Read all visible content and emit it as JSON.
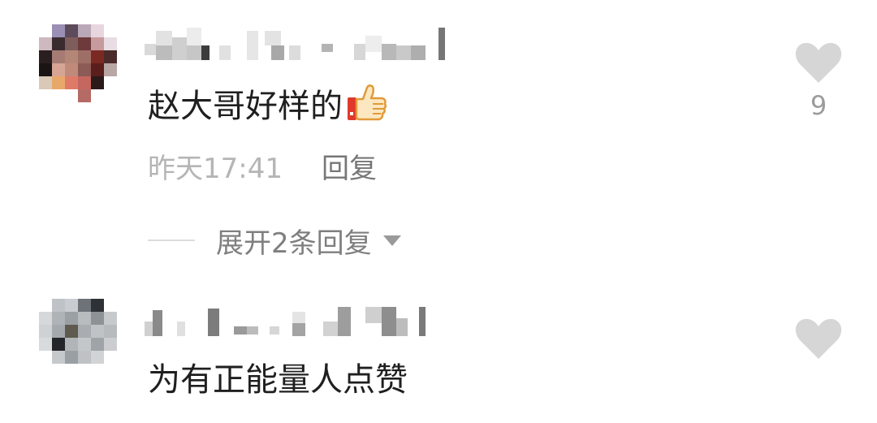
{
  "colors": {
    "text": "#1f1f1f",
    "meta": "#b5b5b5",
    "reply": "#777777",
    "heart": "#d6d6d6"
  },
  "comments": [
    {
      "text": "赵大哥好样的",
      "emoji": "thumbs-up-icon",
      "time": "昨天17:41",
      "reply_label": "回复",
      "expand_label": "展开2条回复",
      "like_count": "9"
    },
    {
      "text": "为有正能量人点赞"
    }
  ]
}
